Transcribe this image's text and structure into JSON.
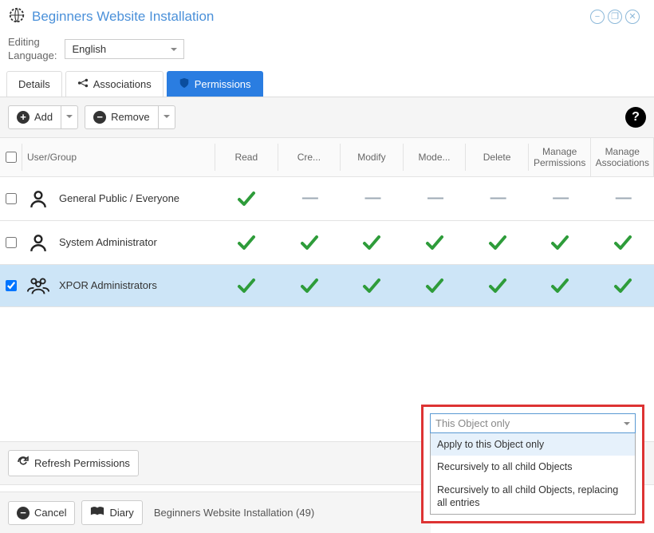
{
  "header": {
    "title": "Beginners Website Installation"
  },
  "language": {
    "label": "Editing\nLanguage:",
    "value": "English"
  },
  "tabs": {
    "details": "Details",
    "associations": "Associations",
    "permissions": "Permissions"
  },
  "toolbar": {
    "add": "Add",
    "remove": "Remove"
  },
  "columns": {
    "name": "User/Group",
    "read": "Read",
    "create": "Cre...",
    "modify": "Modify",
    "moderate": "Mode...",
    "delete": "Delete",
    "manage_perm": "Manage Permissions",
    "manage_assoc": "Manage Associations"
  },
  "rows": [
    {
      "name": "General Public / Everyone",
      "icon": "person",
      "selected": false,
      "checked": false,
      "perms": [
        "check",
        "dash",
        "dash",
        "dash",
        "dash",
        "dash",
        "dash"
      ]
    },
    {
      "name": "System Administrator",
      "icon": "person",
      "selected": false,
      "checked": false,
      "perms": [
        "check",
        "check",
        "check",
        "check",
        "check",
        "check",
        "check"
      ]
    },
    {
      "name": "XPOR Administrators",
      "icon": "group",
      "selected": true,
      "checked": true,
      "perms": [
        "check",
        "check",
        "check",
        "check",
        "check",
        "check",
        "check"
      ]
    }
  ],
  "refresh": "Refresh Permissions",
  "footer": {
    "cancel": "Cancel",
    "diary": "Diary",
    "breadcrumb": "Beginners Website Installation (49)"
  },
  "dropdown": {
    "placeholder": "This Object only",
    "options": [
      "Apply to this Object only",
      "Recursively to all child Objects",
      "Recursively to all child Objects, replacing all entries"
    ]
  }
}
